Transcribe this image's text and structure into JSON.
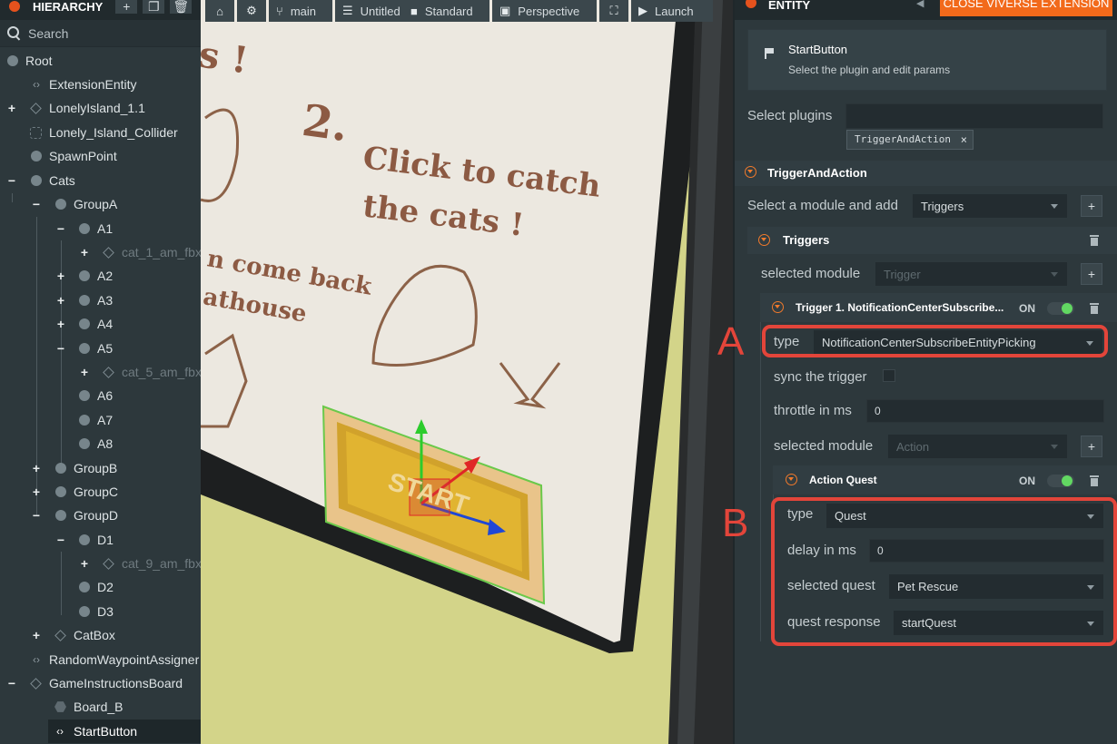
{
  "hierarchy": {
    "title": "HIERARCHY",
    "search_placeholder": "Search",
    "nodes": [
      {
        "label": "Root"
      },
      {
        "label": "ExtensionEntity"
      },
      {
        "label": "LonelyIsland_1.1"
      },
      {
        "label": "Lonely_Island_Collider"
      },
      {
        "label": "SpawnPoint"
      },
      {
        "label": "Cats"
      },
      {
        "label": "GroupA"
      },
      {
        "label": "A1"
      },
      {
        "label": "cat_1_am_fbx"
      },
      {
        "label": "A2"
      },
      {
        "label": "A3"
      },
      {
        "label": "A4"
      },
      {
        "label": "A5"
      },
      {
        "label": "cat_5_am_fbx"
      },
      {
        "label": "A6"
      },
      {
        "label": "A7"
      },
      {
        "label": "A8"
      },
      {
        "label": "GroupB"
      },
      {
        "label": "GroupC"
      },
      {
        "label": "GroupD"
      },
      {
        "label": "D1"
      },
      {
        "label": "cat_9_am_fbx"
      },
      {
        "label": "D2"
      },
      {
        "label": "D3"
      },
      {
        "label": "CatBox"
      },
      {
        "label": "RandomWaypointAssigner"
      },
      {
        "label": "GameInstructionsBoard"
      },
      {
        "label": "Board_B"
      },
      {
        "label": "StartButton"
      }
    ]
  },
  "viewport": {
    "toolbar": {
      "branch": "main",
      "scene": "Untitled",
      "quality": "Standard",
      "camera": "Perspective",
      "launch": "Launch"
    },
    "board": {
      "top_text": "s !",
      "step_number": "2.",
      "line1": "Click to catch",
      "line2": "the cats !",
      "side_line1": "n come back",
      "side_line2": "athouse",
      "button_text": "START"
    }
  },
  "entity": {
    "title": "ENTITY",
    "close_label": "CLOSE VIVERSE EXTENSION",
    "card": {
      "name": "StartButton",
      "desc": "Select the plugin and edit params"
    },
    "select_plugins_label": "Select plugins",
    "plugin_chip": "TriggerAndAction",
    "plugin_section": "TriggerAndAction",
    "select_module_label": "Select a module and add",
    "select_module_value": "Triggers",
    "triggers_section": "Triggers",
    "triggers_selected_module_label": "selected module",
    "triggers_selected_module_value": "Trigger",
    "trigger1": {
      "title": "Trigger 1. NotificationCenterSubscribe...",
      "on": "ON",
      "type_label": "type",
      "type_value": "NotificationCenterSubscribeEntityPicking",
      "sync_label": "sync the trigger",
      "throttle_label": "throttle in ms",
      "throttle_value": "0",
      "selected_module_label": "selected module",
      "selected_module_value": "Action"
    },
    "action": {
      "title": "Action Quest",
      "on": "ON",
      "type_label": "type",
      "type_value": "Quest",
      "delay_label": "delay in ms",
      "delay_value": "0",
      "quest_label": "selected quest",
      "quest_value": "Pet Rescue",
      "response_label": "quest response",
      "response_value": "startQuest"
    },
    "annotation_a": "A",
    "annotation_b": "B"
  },
  "colors": {
    "accent_orange": "#f26a1b",
    "annotation_red": "#e3453a",
    "toggle_green": "#62d862"
  }
}
